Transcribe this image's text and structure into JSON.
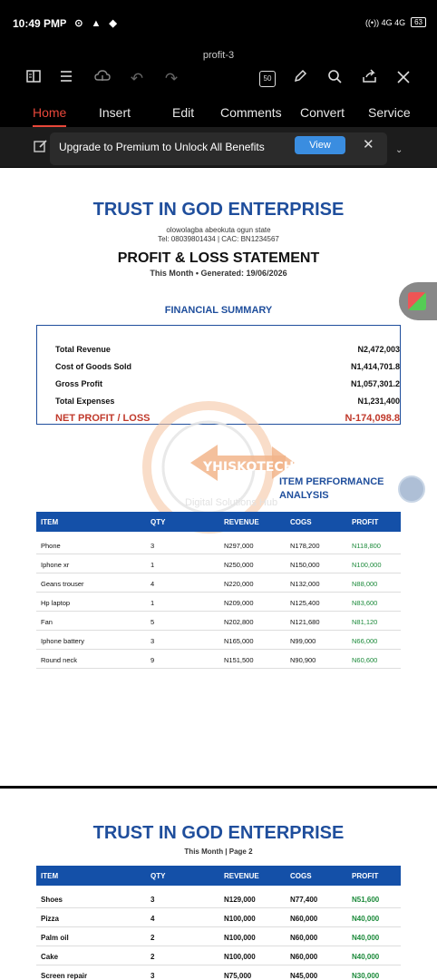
{
  "status_bar": {
    "time": "10:49 PM",
    "left_icons": "P ⊙ ▲ ◆",
    "network": "((•)) 4G 4G",
    "battery": "63"
  },
  "document": {
    "title": "profit-3"
  },
  "toolbar": {
    "icons": [
      "book-icon",
      "menu-icon",
      "cloud-save-icon",
      "undo-icon",
      "redo-icon",
      "zoom-box",
      "pen-icon",
      "search-icon",
      "share-icon",
      "close-icon"
    ],
    "zoom_label": "50"
  },
  "menu": {
    "tabs": [
      "Home",
      "Insert",
      "Edit",
      "Comments",
      "Convert",
      "Service"
    ],
    "active": "Home"
  },
  "premium": {
    "text": "Upgrade to Premium to Unlock All Benefits",
    "button": "View"
  },
  "page1": {
    "company": "TRUST IN GOD ENTERPRISE",
    "address": "olowolagba abeokuta ogun state",
    "contact": "Tel: 08039801434 | CAC: BN1234567",
    "report_title": "PROFIT & LOSS STATEMENT",
    "subtitle": "This Month • Generated: 19/06/2026",
    "summary_title": "FINANCIAL SUMMARY",
    "summary": [
      {
        "label": "Total Revenue",
        "value": "N2,472,003"
      },
      {
        "label": "Cost of Goods Sold",
        "value": "N1,414,701.8"
      },
      {
        "label": "Gross Profit",
        "value": "N1,057,301.2"
      },
      {
        "label": "Total Expenses",
        "value": "N1,231,400"
      },
      {
        "label": "NET PROFIT / LOSS",
        "value": "N-174,098.8"
      }
    ],
    "watermark": {
      "brand": "YHISKOTECH",
      "tagline": "Digital Solutions Hub"
    },
    "performance_title_1": "ITEM PERFORMANCE",
    "performance_title_2": "ANALYSIS",
    "table": {
      "headers": [
        "ITEM",
        "QTY",
        "REVENUE",
        "COGS",
        "PROFIT"
      ],
      "rows": [
        [
          "Phone",
          "3",
          "N297,000",
          "N178,200",
          "N118,800"
        ],
        [
          "Iphone xr",
          "1",
          "N250,000",
          "N150,000",
          "N100,000"
        ],
        [
          "Geans trouser",
          "4",
          "N220,000",
          "N132,000",
          "N88,000"
        ],
        [
          "Hp laptop",
          "1",
          "N209,000",
          "N125,400",
          "N83,600"
        ],
        [
          "Fan",
          "5",
          "N202,800",
          "N121,680",
          "N81,120"
        ],
        [
          "Iphone battery",
          "3",
          "N165,000",
          "N99,000",
          "N66,000"
        ],
        [
          "Round neck",
          "9",
          "N151,500",
          "N90,900",
          "N60,600"
        ]
      ]
    }
  },
  "page2": {
    "company": "TRUST IN GOD ENTERPRISE",
    "subtitle": "This Month | Page 2",
    "table": {
      "headers": [
        "ITEM",
        "QTY",
        "REVENUE",
        "COGS",
        "PROFIT"
      ],
      "rows": [
        [
          "Shoes",
          "3",
          "N129,000",
          "N77,400",
          "N51,600"
        ],
        [
          "Pizza",
          "4",
          "N100,000",
          "N60,000",
          "N40,000"
        ],
        [
          "Palm oil",
          "2",
          "N100,000",
          "N60,000",
          "N40,000"
        ],
        [
          "Cake",
          "2",
          "N100,000",
          "N60,000",
          "N40,000"
        ],
        [
          "Screen repair",
          "3",
          "N75,000",
          "N45,000",
          "N30,000"
        ]
      ]
    }
  }
}
